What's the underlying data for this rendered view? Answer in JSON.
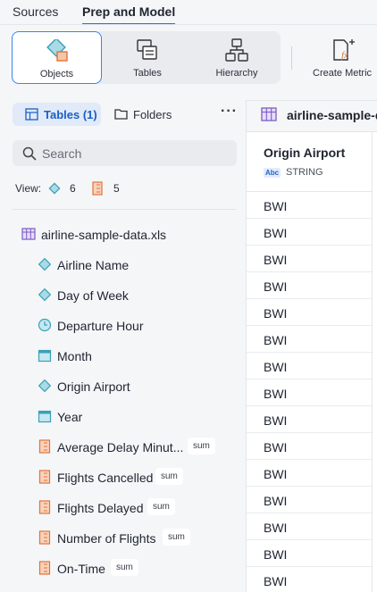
{
  "top_tabs": {
    "sources": "Sources",
    "prep": "Prep and Model"
  },
  "toolbar": {
    "objects": "Objects",
    "tables": "Tables",
    "hierarchy": "Hierarchy",
    "create_metric": "Create Metric"
  },
  "panel": {
    "tables_label": "Tables",
    "tables_count": "(1)",
    "folders_label": "Folders",
    "more": "···",
    "search_placeholder": "Search",
    "view_label": "View:",
    "view_dimensions": "6",
    "view_measures": "5"
  },
  "tree": {
    "table_name": "airline-sample-data.xls",
    "fields": [
      {
        "name": "Airline Name",
        "icon": "dimension-icon"
      },
      {
        "name": "Day of Week",
        "icon": "dimension-icon"
      },
      {
        "name": "Departure Hour",
        "icon": "clock-icon"
      },
      {
        "name": "Month",
        "icon": "calendar-icon"
      },
      {
        "name": "Origin Airport",
        "icon": "dimension-icon"
      },
      {
        "name": "Year",
        "icon": "calendar-icon"
      },
      {
        "name": "Average Delay Minut...",
        "icon": "measure-icon",
        "badge": "sum"
      },
      {
        "name": "Flights Cancelled",
        "icon": "measure-icon",
        "badge": "sum"
      },
      {
        "name": "Flights Delayed",
        "icon": "measure-icon",
        "badge": "sum"
      },
      {
        "name": "Number of Flights",
        "icon": "measure-icon",
        "badge": "sum"
      },
      {
        "name": "On-Time",
        "icon": "measure-icon",
        "badge": "sum"
      }
    ]
  },
  "grid": {
    "table_title": "airline-sample-d",
    "column": {
      "name": "Origin Airport",
      "type_badge": "Abc",
      "type": "STRING"
    },
    "rows": [
      "BWI",
      "BWI",
      "BWI",
      "BWI",
      "BWI",
      "BWI",
      "BWI",
      "BWI",
      "BWI",
      "BWI",
      "BWI",
      "BWI",
      "BWI",
      "BWI",
      "BWI"
    ]
  },
  "colors": {
    "accent": "#1a73e8",
    "dimension": "#4fb3c8",
    "measure": "#e0733a"
  }
}
